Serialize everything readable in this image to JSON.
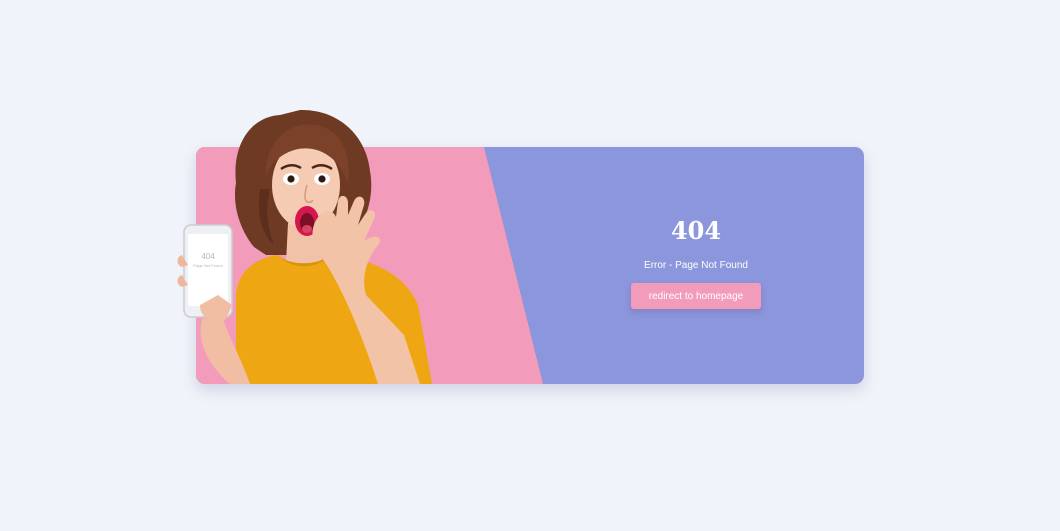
{
  "error": {
    "code": "404",
    "message": "Error - Page Not Found",
    "button_label": "redirect to homepage"
  },
  "phone_screen": {
    "code": "404",
    "message": "Page Not Found"
  },
  "colors": {
    "page_background": "#f0f3f9",
    "card_blue": "#8c96dc",
    "card_pink": "#f29bbb",
    "button_pink": "#f29bbb",
    "shirt_yellow": "#eea713",
    "hair_brown": "#6e3a24"
  },
  "icons": {
    "illustration": "surprised-woman-holding-phone"
  }
}
